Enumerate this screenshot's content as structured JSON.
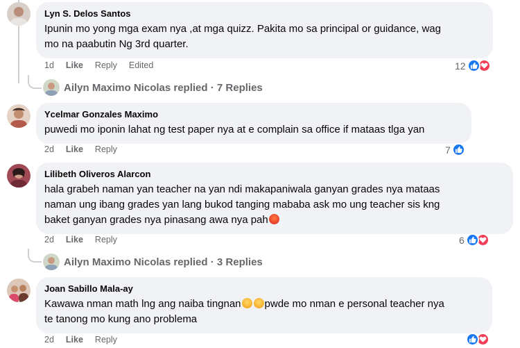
{
  "comments": [
    {
      "author": "Lyn S. Delos Santos",
      "lines": [
        "Ipunin mo yong mga exam nya ,at mga quizz. Pakita mo sa principal or guidance, wag",
        "mo na paabutin Ng 3rd quarter."
      ],
      "time": "1d",
      "like": "Like",
      "reply": "Reply",
      "edited": "Edited",
      "reaction_count": "12",
      "replies": "Ailyn Maximo Nicolas replied · 7 Replies"
    },
    {
      "author": "Ycelmar Gonzales Maximo",
      "lines": [
        "puwedi mo iponin lahat ng test paper nya at e complain sa office if mataas tlga yan"
      ],
      "time": "2d",
      "like": "Like",
      "reply": "Reply",
      "reaction_count": "7"
    },
    {
      "author": "Lilibeth Oliveros Alarcon",
      "lines": [
        "hala grabeh naman yan teacher na yan ndi makapaniwala ganyan grades nya mataas",
        "naman ung ibang grades yan lang bukod tanging mababa ask mo ung teacher sis kng",
        "baket ganyan grades nya pinasang awa nya pah"
      ],
      "time": "2d",
      "like": "Like",
      "reply": "Reply",
      "reaction_count": "6",
      "replies": "Ailyn Maximo Nicolas replied · 3 Replies"
    },
    {
      "author": "Joan Sabillo Mala-ay",
      "lines": [
        "Kawawa nman math lng ang naiba tingnan",
        "pwde mo nman e personal teacher nya",
        "te tanong mo kung ano problema"
      ],
      "time": "2d",
      "like": "Like",
      "reply": "Reply"
    }
  ],
  "icons": {
    "like": "thumbs-up-icon",
    "love": "heart-icon",
    "angry": "angry-emoji",
    "sad": "sad-emoji"
  },
  "colors": {
    "bubble": "#f0f2f5",
    "like_blue": "#1877f2",
    "love_red": "#f33e58",
    "meta_gray": "#65676b"
  }
}
